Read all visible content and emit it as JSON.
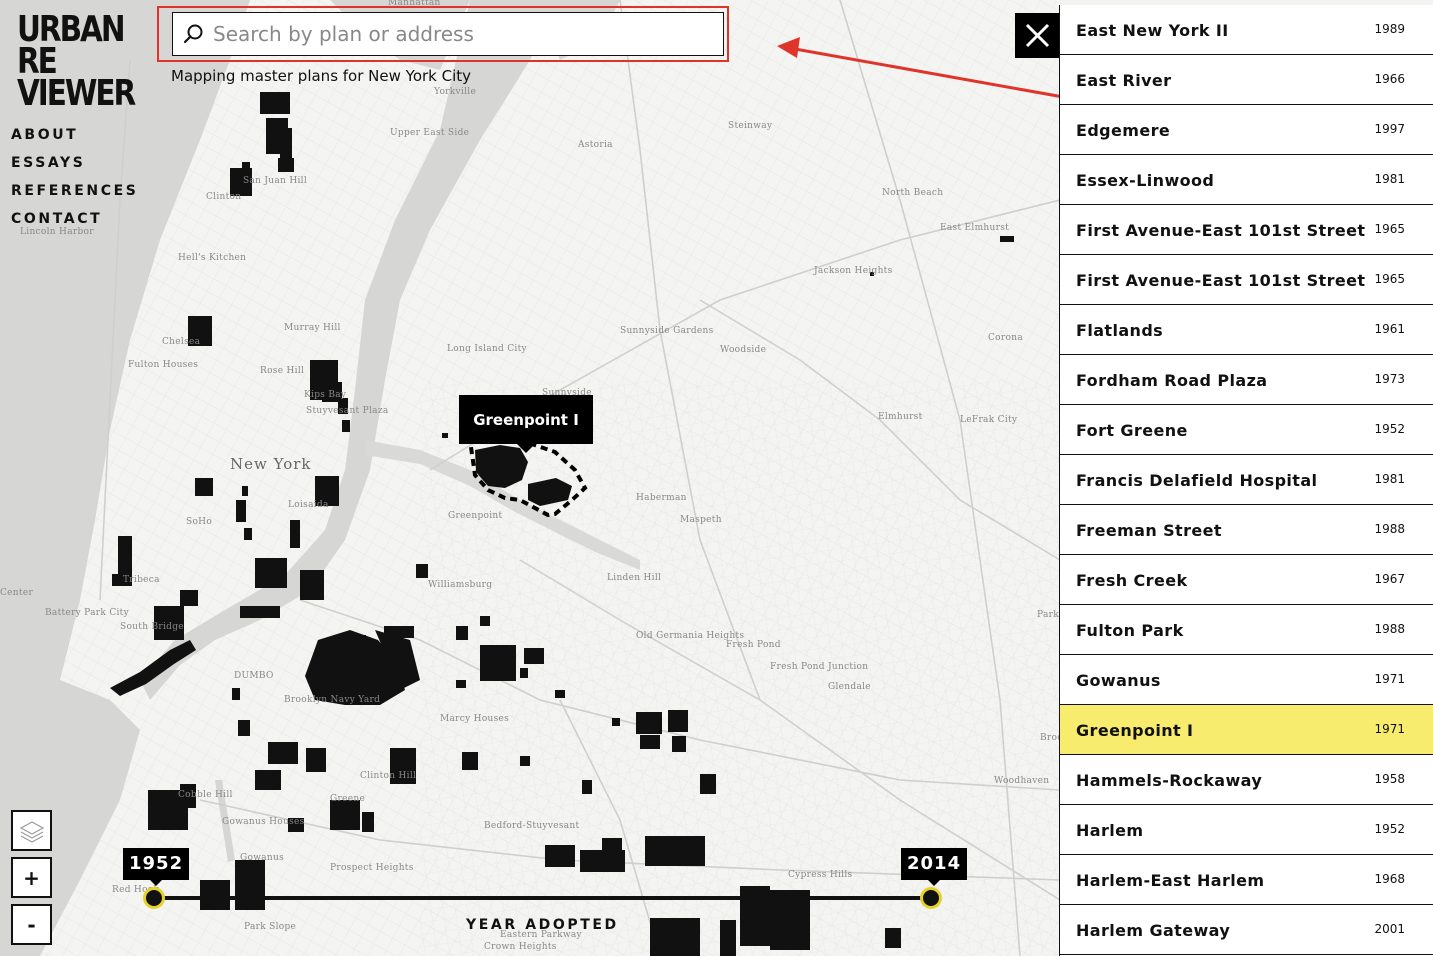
{
  "app": {
    "logo_lines": [
      "URBAN",
      "RE",
      "VIEWER"
    ],
    "tagline": "Mapping master plans for New York City"
  },
  "nav": [
    {
      "label": "ABOUT"
    },
    {
      "label": "ESSAYS"
    },
    {
      "label": "REFERENCES"
    },
    {
      "label": "CONTACT"
    }
  ],
  "search": {
    "placeholder": "Search by plan or address",
    "value": "",
    "icon": "search-icon",
    "highlight_color": "#e0342a"
  },
  "close_icon": "close-icon",
  "tooltip": {
    "label": "Greenpoint I"
  },
  "map_controls": {
    "layers_icon": "layers-icon",
    "zoom_in_label": "+",
    "zoom_out_label": "-"
  },
  "timeline": {
    "start_year": "1952",
    "end_year": "2014",
    "label": "YEAR ADOPTED",
    "handle_color": "#e6d22a"
  },
  "map_labels": [
    {
      "text": "Manhattan"
    },
    {
      "text": "Yorkville"
    },
    {
      "text": "Upper East Side"
    },
    {
      "text": "Astoria"
    },
    {
      "text": "Steinway"
    },
    {
      "text": "North Beach"
    },
    {
      "text": "East Elmhurst"
    },
    {
      "text": "San Juan Hill"
    },
    {
      "text": "Clinton"
    },
    {
      "text": "Lincoln Harbor"
    },
    {
      "text": "Hell's Kitchen"
    },
    {
      "text": "Jackson Heights"
    },
    {
      "text": "Murray Hill"
    },
    {
      "text": "Sunnyside Gardens"
    },
    {
      "text": "Woodside"
    },
    {
      "text": "Corona"
    },
    {
      "text": "Chelsea"
    },
    {
      "text": "Fulton Houses"
    },
    {
      "text": "Long Island City"
    },
    {
      "text": "Sunnyside"
    },
    {
      "text": "Rose Hill"
    },
    {
      "text": "Kips Bay"
    },
    {
      "text": "Stuyvesant Plaza"
    },
    {
      "text": "Elmhurst"
    },
    {
      "text": "LeFrak City"
    },
    {
      "text": "New York"
    },
    {
      "text": "Loisaida"
    },
    {
      "text": "SoHo"
    },
    {
      "text": "Greenpoint"
    },
    {
      "text": "Haberman"
    },
    {
      "text": "Maspeth"
    },
    {
      "text": "Tribeca"
    },
    {
      "text": "Williamsburg"
    },
    {
      "text": "Linden Hill"
    },
    {
      "text": "Battery Park City"
    },
    {
      "text": "South Bridge"
    },
    {
      "text": "Old Germania Heights"
    },
    {
      "text": "Fresh Pond"
    },
    {
      "text": "Fresh Pond Junction"
    },
    {
      "text": "Glendale"
    },
    {
      "text": "DUMBO"
    },
    {
      "text": "Brooklyn Navy Yard"
    },
    {
      "text": "Marcy Houses"
    },
    {
      "text": "Clinton Hill"
    },
    {
      "text": "Woodhaven"
    },
    {
      "text": "Cobble Hill"
    },
    {
      "text": "Greene"
    },
    {
      "text": "Gowanus Houses"
    },
    {
      "text": "Bedford-Stuyvesant"
    },
    {
      "text": "Gowanus"
    },
    {
      "text": "Prospect Heights"
    },
    {
      "text": "Red Hook"
    },
    {
      "text": "Cypress Hills"
    },
    {
      "text": "Park Slope"
    },
    {
      "text": "Eastern Parkway"
    },
    {
      "text": "Crown Heights"
    },
    {
      "text": "Center"
    },
    {
      "text": "Park"
    },
    {
      "text": "Broo"
    }
  ],
  "plans": [
    {
      "name": "East New York II",
      "year": "1989"
    },
    {
      "name": "East River",
      "year": "1966"
    },
    {
      "name": "Edgemere",
      "year": "1997"
    },
    {
      "name": "Essex-Linwood",
      "year": "1981"
    },
    {
      "name": "First Avenue-East 101st Street",
      "year": "1965"
    },
    {
      "name": "First Avenue-East 101st Street",
      "year": "1965"
    },
    {
      "name": "Flatlands",
      "year": "1961"
    },
    {
      "name": "Fordham Road Plaza",
      "year": "1973"
    },
    {
      "name": "Fort Greene",
      "year": "1952"
    },
    {
      "name": "Francis Delafield Hospital",
      "year": "1981"
    },
    {
      "name": "Freeman Street",
      "year": "1988"
    },
    {
      "name": "Fresh Creek",
      "year": "1967"
    },
    {
      "name": "Fulton Park",
      "year": "1988"
    },
    {
      "name": "Gowanus",
      "year": "1971"
    },
    {
      "name": "Greenpoint I",
      "year": "1971",
      "selected": true
    },
    {
      "name": "Hammels-Rockaway",
      "year": "1958"
    },
    {
      "name": "Harlem",
      "year": "1952"
    },
    {
      "name": "Harlem-East Harlem",
      "year": "1968"
    },
    {
      "name": "Harlem Gateway",
      "year": "2001"
    }
  ],
  "colors": {
    "selected_row": "#f7ec6d",
    "annotation_arrow": "#e0342a",
    "water": "#d4d4d2",
    "land": "#f4f4f2"
  }
}
